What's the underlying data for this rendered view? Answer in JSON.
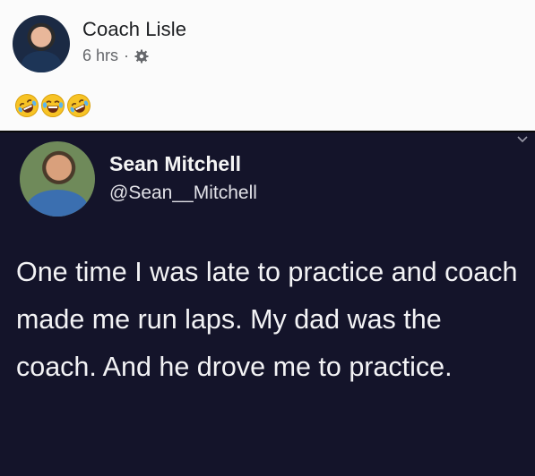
{
  "facebook_post": {
    "author_name": "Coach Lisle",
    "timestamp": "6 hrs",
    "separator": "·",
    "privacy_icon": "gear-icon",
    "reactions": [
      "rofl-emoji",
      "laughing-tears-emoji",
      "rofl-emoji"
    ]
  },
  "tweet": {
    "display_name": "Sean Mitchell",
    "handle": "@Sean__Mitchell",
    "text": "One time I was late to practice and coach made me run laps. My dad was the coach. And he drove me to practice."
  },
  "colors": {
    "tweet_background": "#14142a",
    "facebook_background": "#fbfbfb",
    "tweet_text": "#f3f3f5"
  }
}
